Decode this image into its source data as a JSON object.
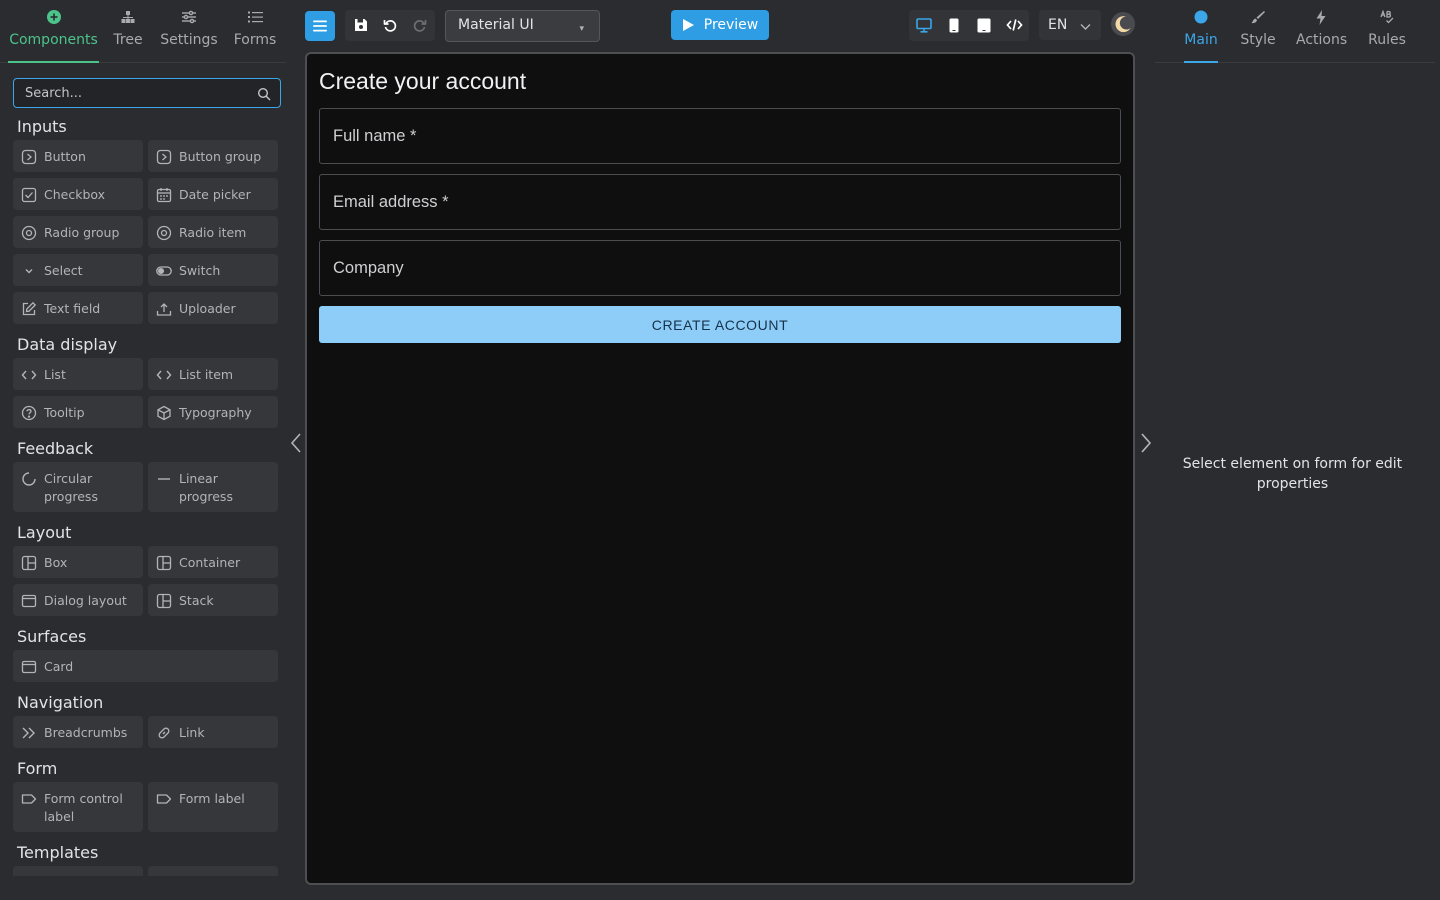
{
  "left_tabs": [
    {
      "label": "Components",
      "icon": "plus-circle-icon",
      "active": true
    },
    {
      "label": "Tree",
      "icon": "sitemap-icon"
    },
    {
      "label": "Settings",
      "icon": "sliders-icon"
    },
    {
      "label": "Forms",
      "icon": "list-icon"
    }
  ],
  "search": {
    "placeholder": "Search..."
  },
  "sections": [
    {
      "title": "Inputs",
      "items": [
        "Button",
        "Button group",
        "Checkbox",
        "Date picker",
        "Radio group",
        "Radio item",
        "Select",
        "Switch",
        "Text field",
        "Uploader"
      ]
    },
    {
      "title": "Data display",
      "items": [
        "List",
        "List item",
        "Tooltip",
        "Typography"
      ]
    },
    {
      "title": "Feedback",
      "items": [
        "Circular progress",
        "Linear progress"
      ]
    },
    {
      "title": "Layout",
      "items": [
        "Box",
        "Container",
        "Dialog layout",
        "Stack"
      ]
    },
    {
      "title": "Surfaces",
      "items": [
        "Card"
      ]
    },
    {
      "title": "Navigation",
      "items": [
        "Breadcrumbs",
        "Link"
      ]
    },
    {
      "title": "Form",
      "items": [
        "Form control label",
        "Form label"
      ]
    },
    {
      "title": "Templates",
      "items": []
    }
  ],
  "toolbar": {
    "library": "Material UI",
    "preview_label": "Preview",
    "language": "EN"
  },
  "form": {
    "title": "Create your account",
    "fields": [
      {
        "placeholder": "Full name *"
      },
      {
        "placeholder": "Email address *"
      },
      {
        "placeholder": "Company"
      }
    ],
    "submit_label": "CREATE ACCOUNT"
  },
  "right_tabs": [
    {
      "label": "Main",
      "active": true
    },
    {
      "label": "Style"
    },
    {
      "label": "Actions"
    },
    {
      "label": "Rules"
    }
  ],
  "right_hint": "Select element on form for edit properties",
  "colors": {
    "accent_green": "#4cc38a",
    "accent_blue": "#2f9de4",
    "submit_button": "#8ecdf8",
    "canvas_bg": "#0f0f10",
    "panel_bg": "#2b2c30"
  }
}
